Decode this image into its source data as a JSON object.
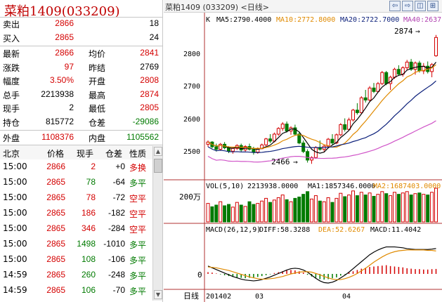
{
  "header": {
    "title": "菜粕1409(033209)"
  },
  "quote": {
    "sell_label": "卖出",
    "sell_price": "2866",
    "sell_qty": "18",
    "buy_label": "买入",
    "buy_price": "2865",
    "buy_qty": "24",
    "rows": [
      {
        "l1": "最新",
        "v1": "2866",
        "l2": "均价",
        "v2": "2841"
      },
      {
        "l1": "涨跌",
        "v1": "97",
        "l2": "昨结",
        "v2": "2769"
      },
      {
        "l1": "幅度",
        "v1": "3.50%",
        "l2": "开盘",
        "v2": "2808"
      },
      {
        "l1": "总手",
        "v1": "2213938",
        "l2": "最高",
        "v2": "2874"
      },
      {
        "l1": "现手",
        "v1": "2",
        "l2": "最低",
        "v2": "2805"
      },
      {
        "l1": "持仓",
        "v1": "815772",
        "l2": "仓差",
        "v2": "-29086"
      }
    ],
    "outer_label": "外盘",
    "outer_val": "1108376",
    "inner_label": "内盘",
    "inner_val": "1105562"
  },
  "ticks": {
    "headers": [
      "北京",
      "价格",
      "现手",
      "仓差",
      "性质"
    ],
    "rows": [
      {
        "time": "15:00",
        "price": "2866",
        "qty": "2",
        "oi": "+0",
        "nature": "多换",
        "color": "red"
      },
      {
        "time": "15:00",
        "price": "2865",
        "qty": "78",
        "oi": "-64",
        "nature": "多平",
        "color": "green"
      },
      {
        "time": "15:00",
        "price": "2865",
        "qty": "78",
        "oi": "-72",
        "nature": "空平",
        "color": "red"
      },
      {
        "time": "15:00",
        "price": "2865",
        "qty": "186",
        "oi": "-182",
        "nature": "空平",
        "color": "red"
      },
      {
        "time": "15:00",
        "price": "2865",
        "qty": "346",
        "oi": "-284",
        "nature": "空平",
        "color": "red"
      },
      {
        "time": "15:00",
        "price": "2865",
        "qty": "1498",
        "oi": "-1010",
        "nature": "多平",
        "color": "green"
      },
      {
        "time": "15:00",
        "price": "2865",
        "qty": "108",
        "oi": "-106",
        "nature": "多平",
        "color": "green"
      },
      {
        "time": "14:59",
        "price": "2865",
        "qty": "260",
        "oi": "-248",
        "nature": "多平",
        "color": "green"
      },
      {
        "time": "14:59",
        "price": "2865",
        "qty": "106",
        "oi": "-70",
        "nature": "多平",
        "color": "green"
      }
    ]
  },
  "chart_header": {
    "title": "菜粕1409 (033209) <日线>",
    "nav": [
      "⇦",
      "⇨",
      "◫",
      "⊞"
    ]
  },
  "ma": {
    "k": "K",
    "ma5": "MA5:2790.4000",
    "ma10": "MA10:2772.8000",
    "ma20": "MA20:2722.7000",
    "ma40": "MA40:2637",
    "colors": {
      "ma5": "#000000",
      "ma10": "#e08a00",
      "ma20": "#0b1f7a",
      "ma40": "#d054c8"
    }
  },
  "price_axis": [
    "2800",
    "2700",
    "2600",
    "2500"
  ],
  "high_mark": "2874",
  "low_mark": "2466",
  "vol": {
    "label": "VOL(5,10)",
    "value": "2213938.0000",
    "ma1": "MA1:1857346.0000",
    "ma2": "MA2:1687403.0000",
    "axis": "200万"
  },
  "macd": {
    "label": "MACD(26,12,9)",
    "diff": "DIFF:58.3288",
    "dea": "DEA:52.6267",
    "macd": "MACD:11.4042",
    "axis_zero": "0"
  },
  "time_axis": {
    "label": "日线",
    "ticks": [
      "201402",
      "03",
      "04"
    ]
  },
  "chart_data": {
    "type": "candlestick",
    "ylim": [
      2420,
      2900
    ],
    "ohlc": [
      [
        2528,
        2540,
        2520,
        2535
      ],
      [
        2535,
        2538,
        2515,
        2520
      ],
      [
        2520,
        2530,
        2505,
        2512
      ],
      [
        2512,
        2532,
        2508,
        2528
      ],
      [
        2528,
        2535,
        2512,
        2517
      ],
      [
        2517,
        2522,
        2500,
        2506
      ],
      [
        2506,
        2520,
        2498,
        2515
      ],
      [
        2515,
        2528,
        2510,
        2524
      ],
      [
        2524,
        2530,
        2505,
        2510
      ],
      [
        2510,
        2525,
        2505,
        2521
      ],
      [
        2521,
        2530,
        2508,
        2512
      ],
      [
        2512,
        2520,
        2495,
        2503
      ],
      [
        2503,
        2518,
        2498,
        2514
      ],
      [
        2514,
        2530,
        2512,
        2526
      ],
      [
        2526,
        2548,
        2522,
        2545
      ],
      [
        2545,
        2560,
        2532,
        2538
      ],
      [
        2538,
        2565,
        2534,
        2560
      ],
      [
        2560,
        2582,
        2555,
        2578
      ],
      [
        2578,
        2598,
        2570,
        2592
      ],
      [
        2592,
        2600,
        2565,
        2570
      ],
      [
        2570,
        2585,
        2558,
        2580
      ],
      [
        2580,
        2590,
        2555,
        2560
      ],
      [
        2560,
        2568,
        2528,
        2532
      ],
      [
        2532,
        2540,
        2500,
        2505
      ],
      [
        2505,
        2512,
        2470,
        2478
      ],
      [
        2478,
        2490,
        2466,
        2486
      ],
      [
        2486,
        2522,
        2482,
        2518
      ],
      [
        2518,
        2540,
        2508,
        2512
      ],
      [
        2512,
        2528,
        2505,
        2522
      ],
      [
        2522,
        2548,
        2518,
        2544
      ],
      [
        2544,
        2560,
        2526,
        2532
      ],
      [
        2532,
        2562,
        2528,
        2558
      ],
      [
        2558,
        2595,
        2554,
        2590
      ],
      [
        2590,
        2610,
        2568,
        2575
      ],
      [
        2575,
        2612,
        2570,
        2605
      ],
      [
        2605,
        2640,
        2600,
        2636
      ],
      [
        2636,
        2658,
        2622,
        2628
      ],
      [
        2628,
        2680,
        2624,
        2675
      ],
      [
        2675,
        2700,
        2660,
        2668
      ],
      [
        2668,
        2712,
        2664,
        2706
      ],
      [
        2706,
        2722,
        2690,
        2695
      ],
      [
        2695,
        2725,
        2690,
        2720
      ],
      [
        2720,
        2760,
        2715,
        2755
      ],
      [
        2755,
        2760,
        2715,
        2720
      ],
      [
        2720,
        2745,
        2700,
        2740
      ],
      [
        2740,
        2770,
        2735,
        2765
      ],
      [
        2765,
        2778,
        2745,
        2750
      ],
      [
        2750,
        2775,
        2742,
        2770
      ],
      [
        2770,
        2795,
        2762,
        2788
      ],
      [
        2788,
        2798,
        2760,
        2765
      ],
      [
        2765,
        2790,
        2748,
        2785
      ],
      [
        2785,
        2792,
        2755,
        2760
      ],
      [
        2760,
        2785,
        2750,
        2775
      ],
      [
        2775,
        2790,
        2752,
        2758
      ],
      [
        2758,
        2785,
        2740,
        2780
      ],
      [
        2808,
        2874,
        2805,
        2866
      ]
    ],
    "volume_ratio": [
      0.55,
      0.45,
      0.5,
      0.6,
      0.48,
      0.52,
      0.44,
      0.58,
      0.5,
      0.46,
      0.6,
      0.52,
      0.55,
      0.62,
      0.7,
      0.58,
      0.65,
      0.72,
      0.8,
      0.66,
      0.6,
      0.7,
      0.74,
      0.82,
      0.9,
      0.68,
      0.78,
      0.62,
      0.6,
      0.72,
      0.58,
      0.7,
      0.85,
      0.75,
      0.8,
      0.92,
      0.78,
      0.88,
      0.8,
      0.86,
      0.76,
      0.82,
      0.9,
      0.84,
      0.78,
      0.88,
      0.82,
      0.86,
      0.9,
      0.8,
      0.84,
      0.86,
      0.82,
      0.8,
      0.88,
      1.0
    ],
    "macd_hist": [
      4,
      3,
      1,
      -1,
      -3,
      -5,
      -7,
      -8,
      -9,
      -10,
      -9,
      -8,
      -7,
      -5,
      -3,
      -1,
      2,
      4,
      6,
      8,
      9,
      8,
      6,
      3,
      -2,
      -6,
      -9,
      -12,
      -13,
      -12,
      -10,
      -8,
      -4,
      -1,
      3,
      6,
      9,
      12,
      14,
      16,
      17,
      18,
      19,
      20,
      18,
      17,
      16,
      15,
      13,
      12,
      11,
      11,
      10,
      10,
      11,
      11.4
    ],
    "diff": [
      18,
      14,
      10,
      6,
      2,
      -2,
      -6,
      -9,
      -12,
      -14,
      -15,
      -16,
      -15,
      -13,
      -10,
      -7,
      -3,
      1,
      5,
      9,
      12,
      13,
      12,
      9,
      4,
      -3,
      -10,
      -16,
      -20,
      -21,
      -19,
      -15,
      -9,
      -3,
      4,
      12,
      20,
      28,
      36,
      44,
      50,
      55,
      59,
      62,
      62,
      62,
      61,
      60,
      58,
      57,
      56,
      56,
      56,
      56,
      57,
      58.3
    ],
    "dea": [
      16,
      15,
      14,
      12,
      10,
      8,
      5,
      2,
      -1,
      -4,
      -7,
      -9,
      -11,
      -12,
      -12,
      -11,
      -10,
      -8,
      -6,
      -3,
      0,
      2,
      4,
      5,
      5,
      4,
      1,
      -2,
      -6,
      -9,
      -12,
      -13,
      -13,
      -11,
      -8,
      -4,
      1,
      7,
      13,
      20,
      27,
      33,
      39,
      44,
      48,
      51,
      53,
      54,
      55,
      55,
      55,
      55,
      55,
      54,
      54,
      52.6
    ]
  }
}
